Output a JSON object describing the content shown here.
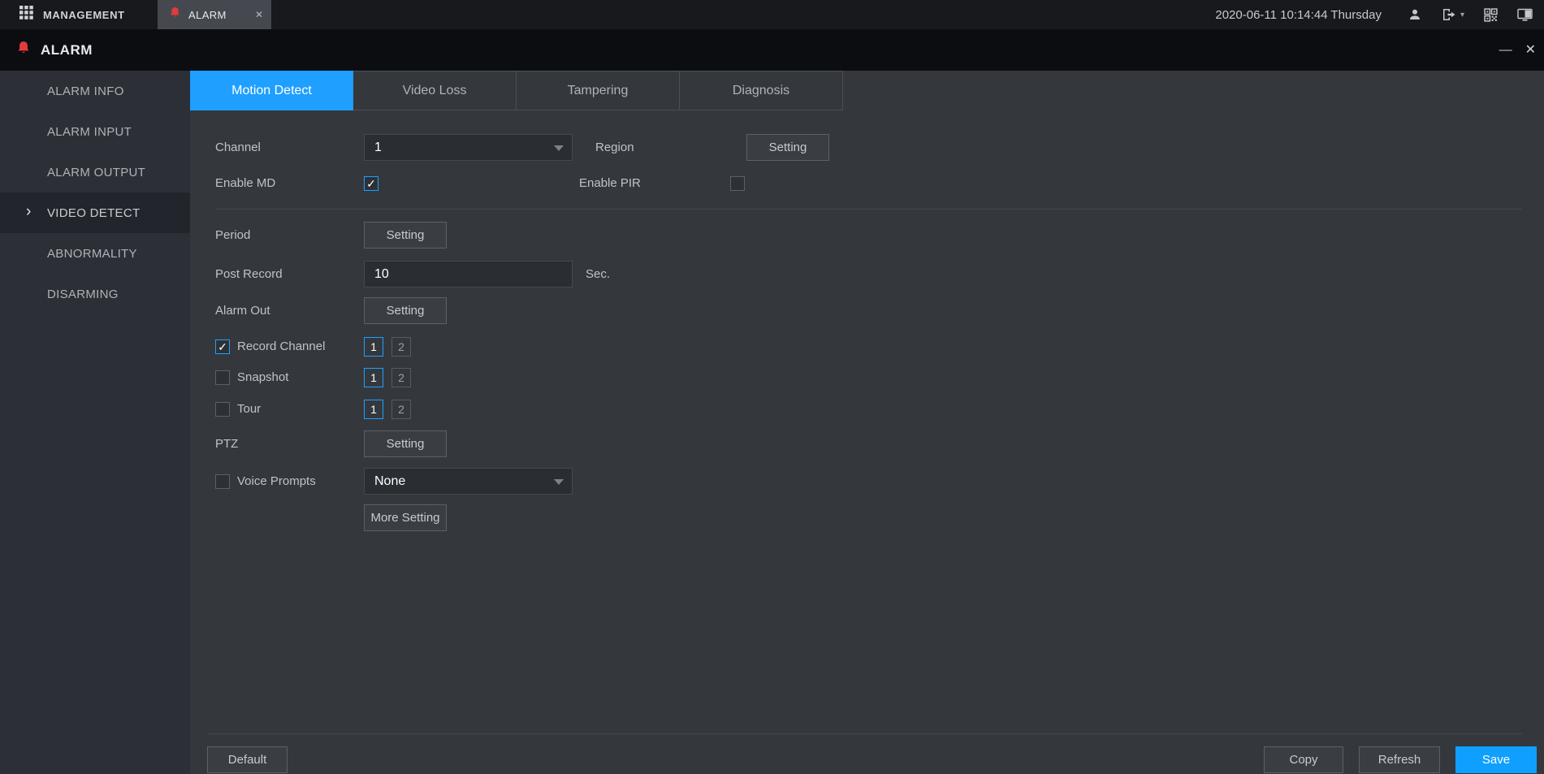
{
  "colors": {
    "accent": "#1f9fff",
    "topbar_bg": "#17191d",
    "titlebar_bg": "#0b0d10",
    "sidebar_bg": "#2c3036",
    "content_bg": "#34383d",
    "alarm_red": "#e23b3b",
    "save_button_bg": "#0f9fff"
  },
  "top_bar": {
    "management_label": "MANAGEMENT",
    "alarm_tab_label": "ALARM",
    "datetime": "2020-06-11 10:14:44 Thursday"
  },
  "title_bar": {
    "title": "ALARM"
  },
  "sidebar": {
    "items": [
      {
        "label": "ALARM INFO",
        "active": false
      },
      {
        "label": "ALARM INPUT",
        "active": false
      },
      {
        "label": "ALARM OUTPUT",
        "active": false
      },
      {
        "label": "VIDEO DETECT",
        "active": true
      },
      {
        "label": "ABNORMALITY",
        "active": false
      },
      {
        "label": "DISARMING",
        "active": false
      }
    ]
  },
  "tabs": [
    {
      "label": "Motion Detect",
      "active": true
    },
    {
      "label": "Video Loss",
      "active": false
    },
    {
      "label": "Tampering",
      "active": false
    },
    {
      "label": "Diagnosis",
      "active": false
    }
  ],
  "form": {
    "channel": {
      "label": "Channel",
      "value": "1"
    },
    "region": {
      "label": "Region",
      "button": "Setting"
    },
    "enable_md": {
      "label": "Enable MD",
      "checked": true
    },
    "enable_pir": {
      "label": "Enable PIR",
      "checked": false
    },
    "period": {
      "label": "Period",
      "button": "Setting"
    },
    "post_record": {
      "label": "Post Record",
      "value": "10",
      "unit": "Sec."
    },
    "alarm_out": {
      "label": "Alarm Out",
      "button": "Setting"
    },
    "record_channel": {
      "label": "Record Channel",
      "checked": true
    },
    "snapshot": {
      "label": "Snapshot",
      "checked": false
    },
    "tour": {
      "label": "Tour",
      "checked": false
    },
    "channel_options": [
      "1",
      "2"
    ],
    "ptz": {
      "label": "PTZ",
      "button": "Setting"
    },
    "voice_prompts": {
      "label": "Voice Prompts",
      "value": "None",
      "checked": false
    },
    "more_setting_button": "More Setting"
  },
  "footer": {
    "default_button": "Default",
    "copy_button": "Copy",
    "refresh_button": "Refresh",
    "save_button": "Save"
  },
  "icons": {
    "close_glyph": "✕",
    "minimize_glyph": "—",
    "caret_glyph": "▾",
    "active_arrow_glyph": "›",
    "check_glyph": "✓"
  }
}
